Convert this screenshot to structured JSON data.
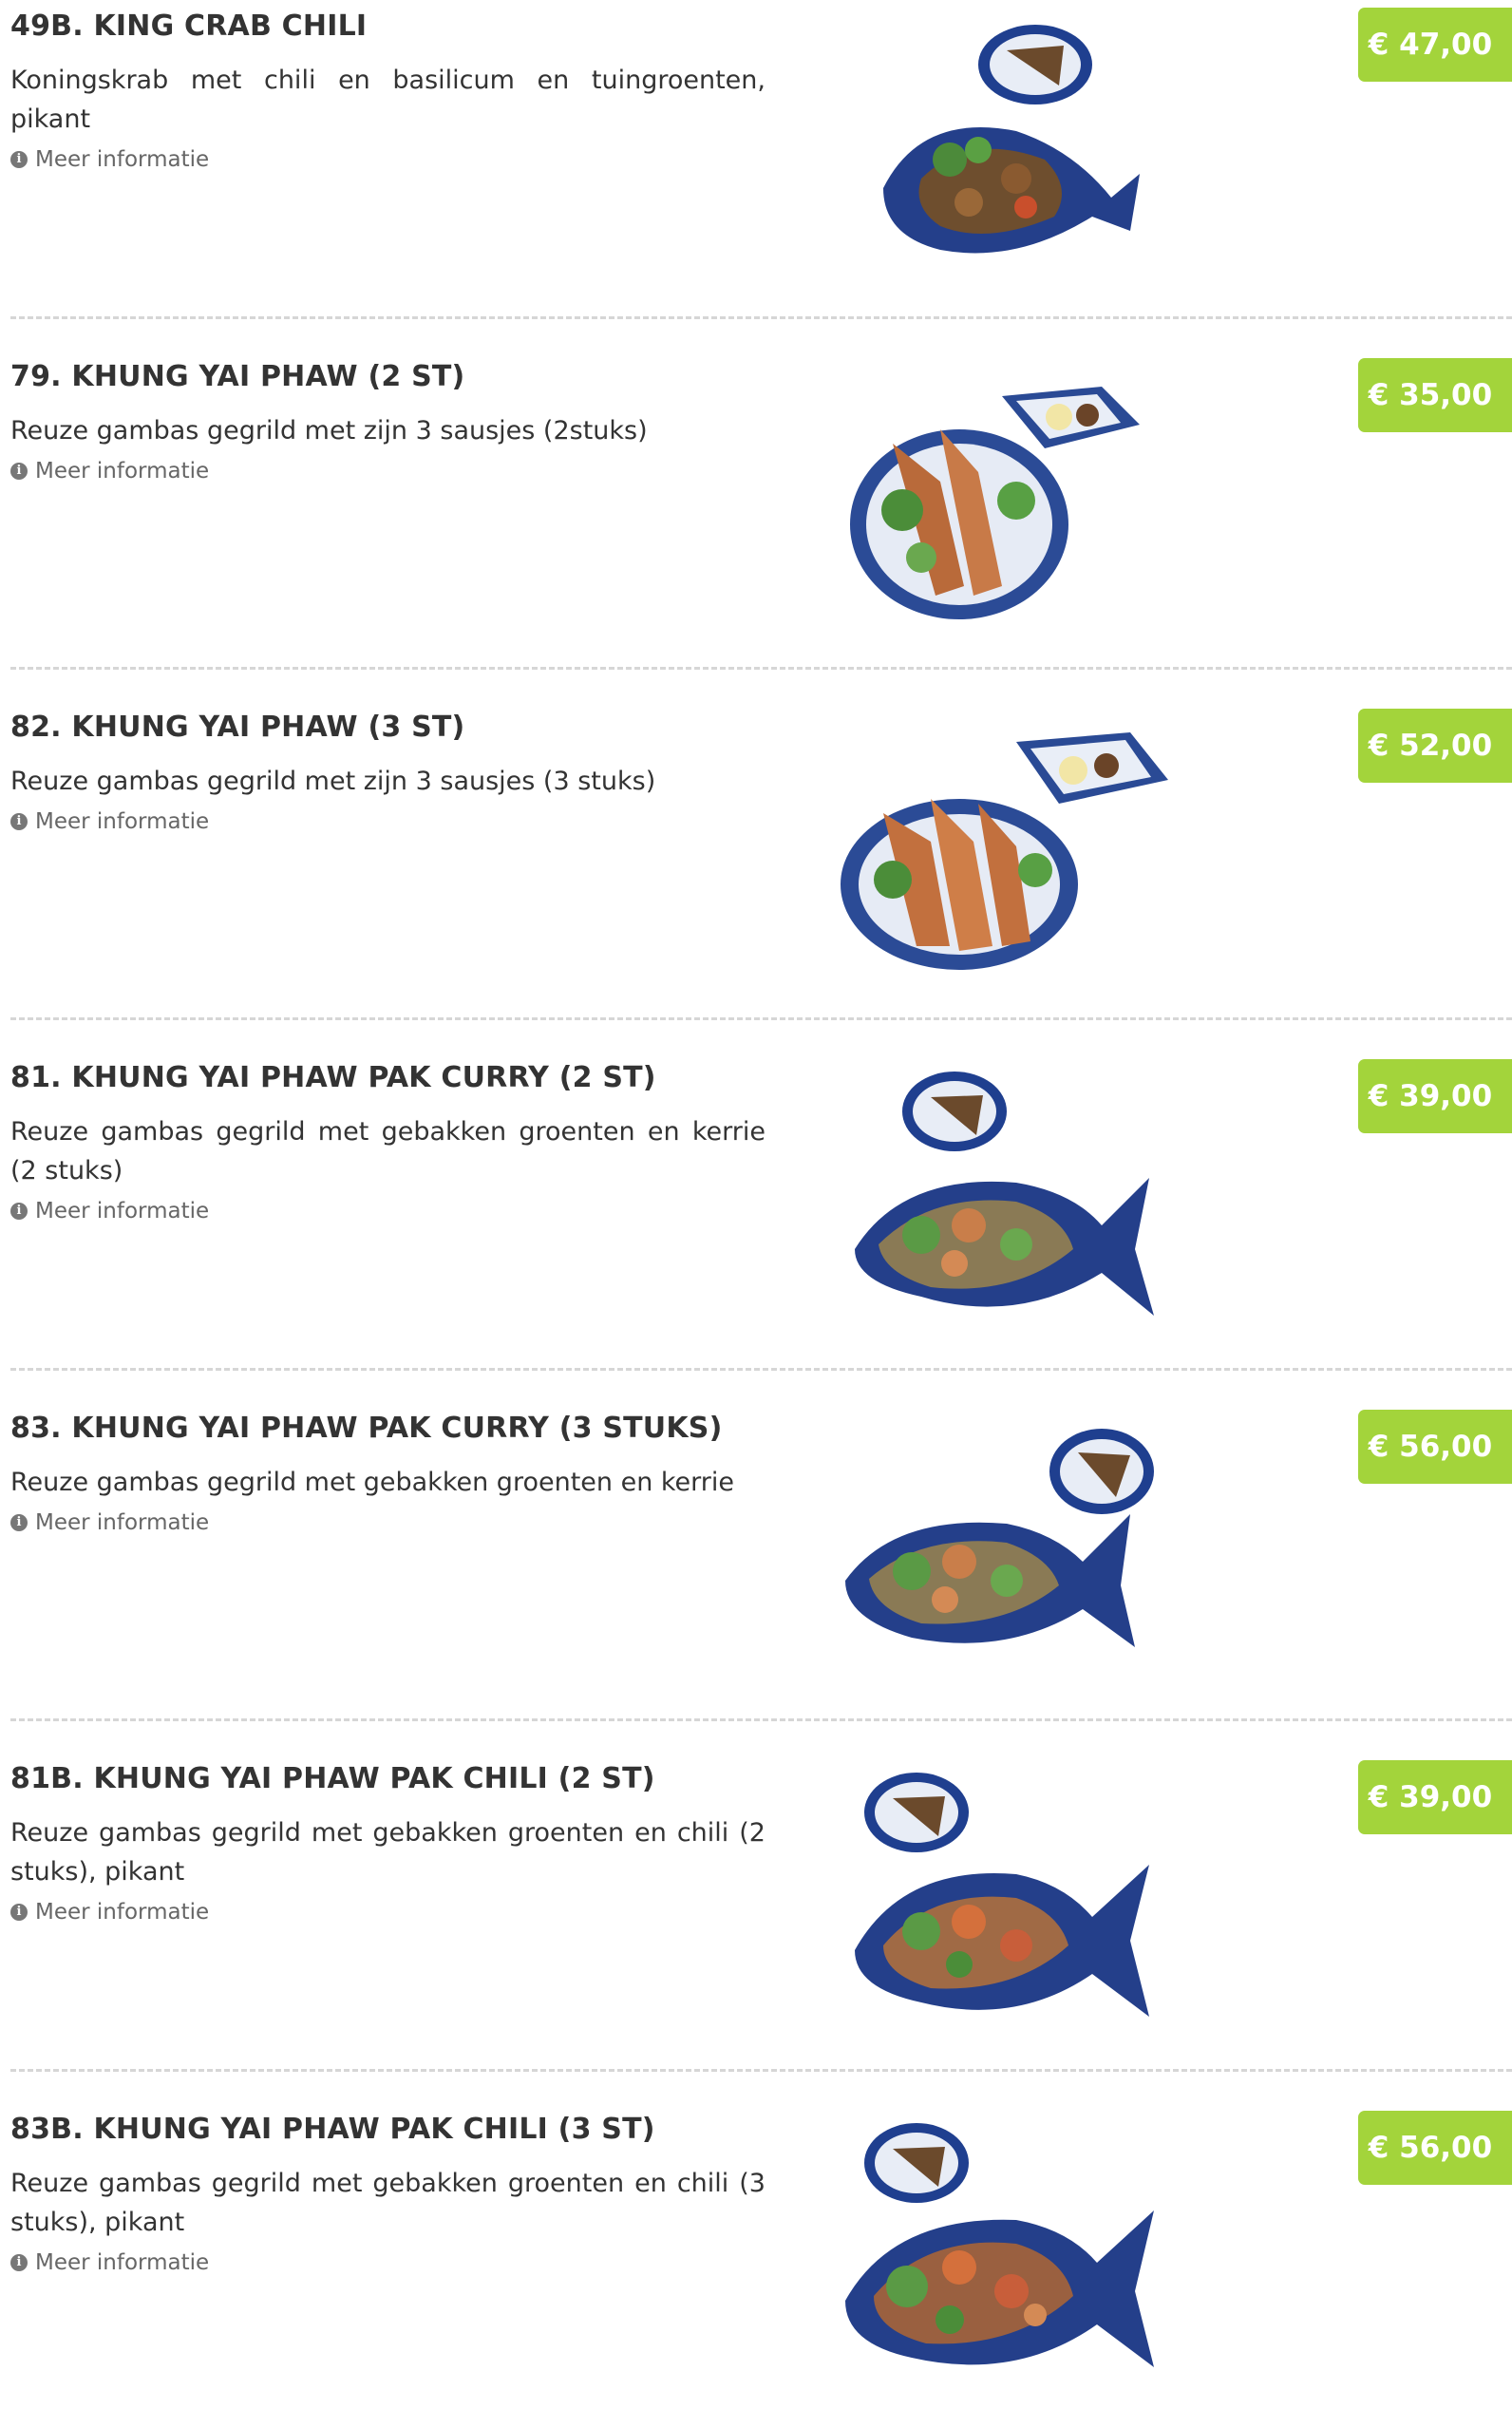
{
  "menu": {
    "more_info_label": "Meer informatie",
    "accent_color": "#a3d43b",
    "items": [
      {
        "title": "49B. KING CRAB CHILI",
        "description": "Koningskrab met chili en basilicum en tuingroenten, pikant",
        "price": "€ 47,00",
        "image": "king-crab-dish"
      },
      {
        "title": "79. KHUNG YAI PHAW (2 ST)",
        "description": "Reuze gambas gegrild met zijn 3 sausjes (2stuks)",
        "price": "€ 35,00",
        "image": "grilled-prawns-dish"
      },
      {
        "title": "82. KHUNG YAI PHAW (3 ST)",
        "description": "Reuze gambas gegrild met zijn 3 sausjes (3 stuks)",
        "price": "€ 52,00",
        "image": "grilled-prawns-dish"
      },
      {
        "title": "81. KHUNG YAI PHAW PAK CURRY (2 ST)",
        "description": "Reuze gambas gegrild met gebakken groenten en kerrie (2 stuks)",
        "price": "€ 39,00",
        "image": "fish-plate-dish"
      },
      {
        "title": "83. KHUNG YAI PHAW PAK CURRY (3 STUKS)",
        "description": "Reuze gambas gegrild met gebakken groenten en kerrie",
        "price": "€ 56,00",
        "image": "fish-plate-dish"
      },
      {
        "title": "81B. KHUNG YAI PHAW PAK CHILI (2 ST)",
        "description": "Reuze gambas gegrild met gebakken groenten en chili (2 stuks), pikant",
        "price": "€ 39,00",
        "image": "fish-plate-dish"
      },
      {
        "title": "83B. KHUNG YAI PHAW PAK CHILI (3 ST)",
        "description": "Reuze gambas gegrild met gebakken groenten en chili (3 stuks), pikant",
        "price": "€ 56,00",
        "image": "fish-plate-dish"
      }
    ]
  }
}
